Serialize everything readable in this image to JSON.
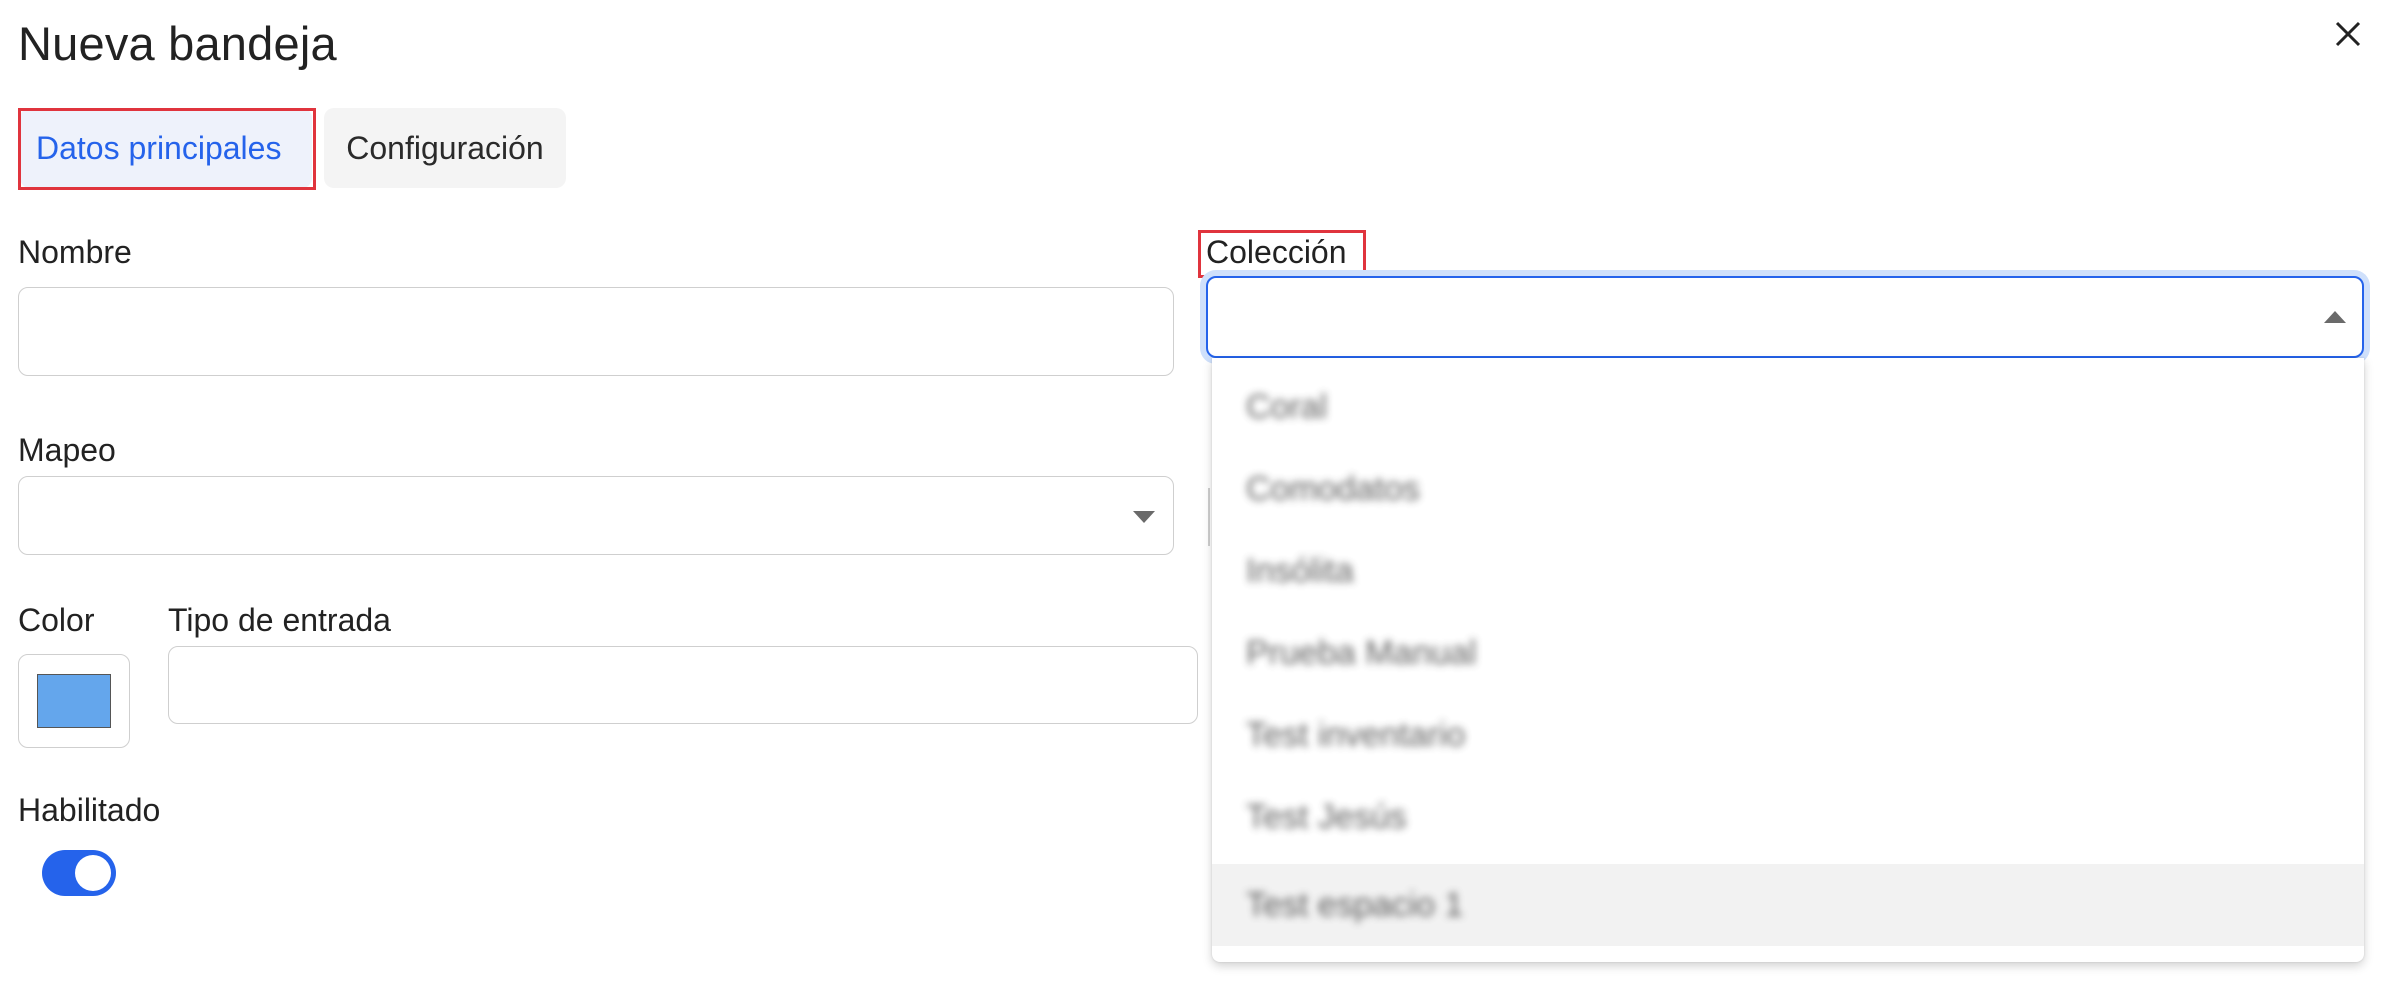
{
  "dialog": {
    "title": "Nueva bandeja",
    "close_icon": "close-icon"
  },
  "tabs": [
    {
      "label": "Datos principales",
      "active": true
    },
    {
      "label": "Configuración",
      "active": false
    }
  ],
  "form": {
    "nombre": {
      "label": "Nombre",
      "value": ""
    },
    "coleccion": {
      "label": "Colección",
      "value": "",
      "open": true,
      "options": [
        "Coral",
        "Comodatos",
        "Insólita",
        "Prueba Manual",
        "Test inventario",
        "Test Jesús",
        "Test espacio 1"
      ],
      "hovered_index": 6
    },
    "mapeo": {
      "label": "Mapeo",
      "value": ""
    },
    "color": {
      "label": "Color",
      "value": "#64a6ec"
    },
    "tipo_entrada": {
      "label": "Tipo de entrada",
      "value": ""
    },
    "habilitado": {
      "label": "Habilitado",
      "value": true
    }
  },
  "colors": {
    "accent": "#2563eb",
    "highlight_outline": "#e0343d",
    "swatch": "#64a6ec"
  }
}
